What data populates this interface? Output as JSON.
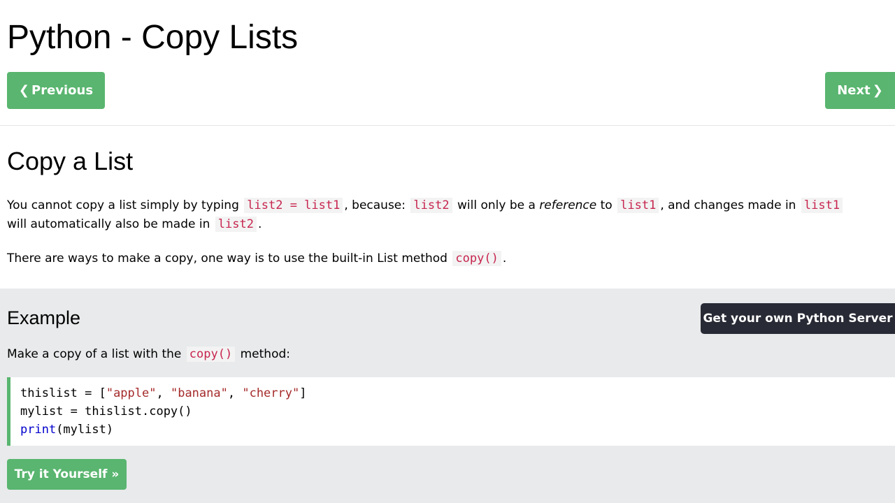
{
  "header": {
    "title": "Python - Copy Lists"
  },
  "nav": {
    "previous_label": "Previous",
    "next_label": "Next",
    "previous_icon": "chevron-left-icon",
    "next_icon": "chevron-right-icon",
    "button_color": "#59b56f"
  },
  "section": {
    "title": "Copy a List",
    "p1": {
      "t1": "You cannot copy a list simply by typing",
      "c1": "list2 = list1",
      "t2": ", because:",
      "c2": "list2",
      "t3": "will only be a",
      "em": "reference",
      "t4": "to",
      "c3": "list1",
      "t5": ", and changes made in",
      "c4": "list1",
      "t6": "will automatically also be made in",
      "c5": "list2",
      "t7": "."
    },
    "p2": {
      "t1": "There are ways to make a copy, one way is to use the built-in List method",
      "c1": "copy()",
      "t2": "."
    }
  },
  "example": {
    "title": "Example",
    "server_button": "Get your own Python Server",
    "desc": {
      "t1": "Make a copy of a list with the",
      "c1": "copy()",
      "t2": "method:"
    },
    "code": {
      "line1": {
        "a": "thislist = [",
        "s1": "\"apple\"",
        "b": ", ",
        "s2": "\"banana\"",
        "c": ", ",
        "s3": "\"cherry\"",
        "d": "]"
      },
      "line2": "mylist = thislist.copy()",
      "line3": {
        "kw": "print",
        "rest": "(mylist)"
      }
    },
    "try_button": "Try it Yourself »",
    "panel_color": "#e8eaeb",
    "server_button_color": "#282a35"
  }
}
